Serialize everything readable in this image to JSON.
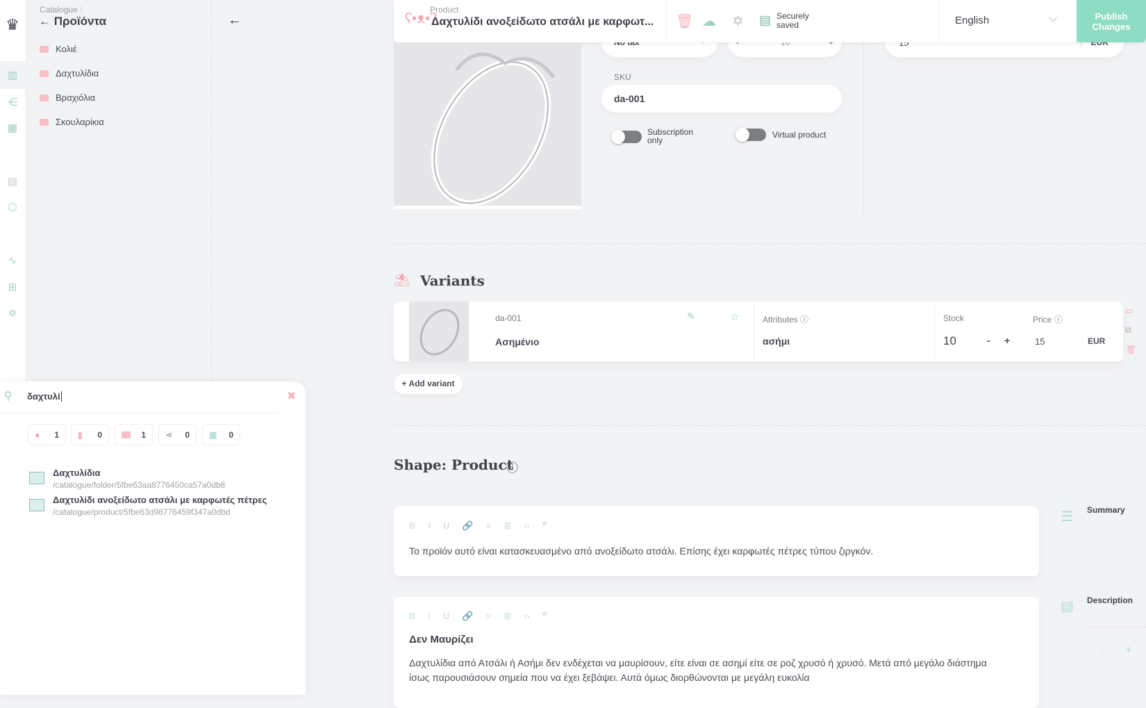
{
  "rail": {
    "icons": [
      "logo-icon",
      "catalogue-icon",
      "topics-icon",
      "grids-icon",
      "orders-icon",
      "shapes-icon",
      "webhooks-icon",
      "tools-icon",
      "settings-icon"
    ]
  },
  "tree": {
    "breadcrumb": "Catalogue",
    "breadcrumb_sep": "/",
    "title": "Προϊόντα",
    "items": [
      {
        "label": "Κολιέ"
      },
      {
        "label": "Δαχτυλίδια"
      },
      {
        "label": "Βραχιόλια"
      },
      {
        "label": "Σκουλαρίκια"
      }
    ]
  },
  "header": {
    "type_label": "Product",
    "title": "Δαχτυλίδι ανοξείδωτο ατσάλι με καρφωτ...",
    "save_status": "Securely saved",
    "language": "English",
    "publish_label": "Publish Changes"
  },
  "product": {
    "tax": "No tax",
    "stock": "10",
    "stock_minus": "-",
    "stock_plus": "+",
    "price": "15",
    "currency": "EUR",
    "sku_label": "SKU",
    "sku": "da-001",
    "subscription_label": "Subscription only",
    "subscription_on": false,
    "virtual_label": "Virtual product",
    "virtual_on": false
  },
  "variants": {
    "title": "Variants",
    "items": [
      {
        "sku": "da-001",
        "name": "Ασημένιο",
        "attributes_label": "Attributes",
        "attribute_value": "ασήμι",
        "stock_label": "Stock",
        "stock": "10",
        "minus": "-",
        "plus": "+",
        "price_label": "Price",
        "price": "15",
        "currency": "EUR"
      }
    ],
    "add_label": "+ Add variant"
  },
  "shape": {
    "title": "Shape: Product",
    "toolbar": [
      "B",
      "I",
      "U",
      "🔗",
      "≡",
      "≣",
      "‹›",
      "❞"
    ],
    "summary": {
      "label": "Summary",
      "text": "Το προϊόν αυτό είναι κατασκευασμένο από ανοξείδωτο ατσάλι. Επίσης έχει καρφωτές πέτρες τύπου ζιργκόν."
    },
    "description": {
      "label": "Description",
      "heading": "Δεν Μαυρίζει",
      "text1": "Δαχτυλίδια από Ατσάλι ή Ασήμι δεν ενδέχεται να μαυρίσουν, είτε είναι σε ασημί είτε σε ροζ χρυσό ή χρυσό. Μετά από μεγάλο διάστημα",
      "text2": "ίσως παρουσιάσουν σημεία που να έχει ξεβάψει. Αυτά όμως διορθώνονται με μεγάλη ευκολία"
    }
  },
  "search": {
    "query": "δαχτυλί",
    "counts": [
      {
        "icon": "product-icon",
        "count": "1"
      },
      {
        "icon": "document-icon",
        "count": "0"
      },
      {
        "icon": "folder-icon",
        "count": "1"
      },
      {
        "icon": "topic-icon",
        "count": "0"
      },
      {
        "icon": "grid-icon",
        "count": "0"
      }
    ],
    "results": [
      {
        "title": "Δαχτυλίδια",
        "path": "/catalogue/folder/5fbe63aa8776450ca57a0db8"
      },
      {
        "title": "Δαχτυλίδι ανοξείδωτο ατσάλι με καρφωτές πέτρες",
        "path": "/catalogue/product/5fbe63d98776459f347a0dbd"
      }
    ]
  },
  "colors": {
    "accent": "#8fdcc4",
    "pink": "#f7b9c0",
    "background": "#f2f3f5",
    "text": "#4a4d57"
  }
}
